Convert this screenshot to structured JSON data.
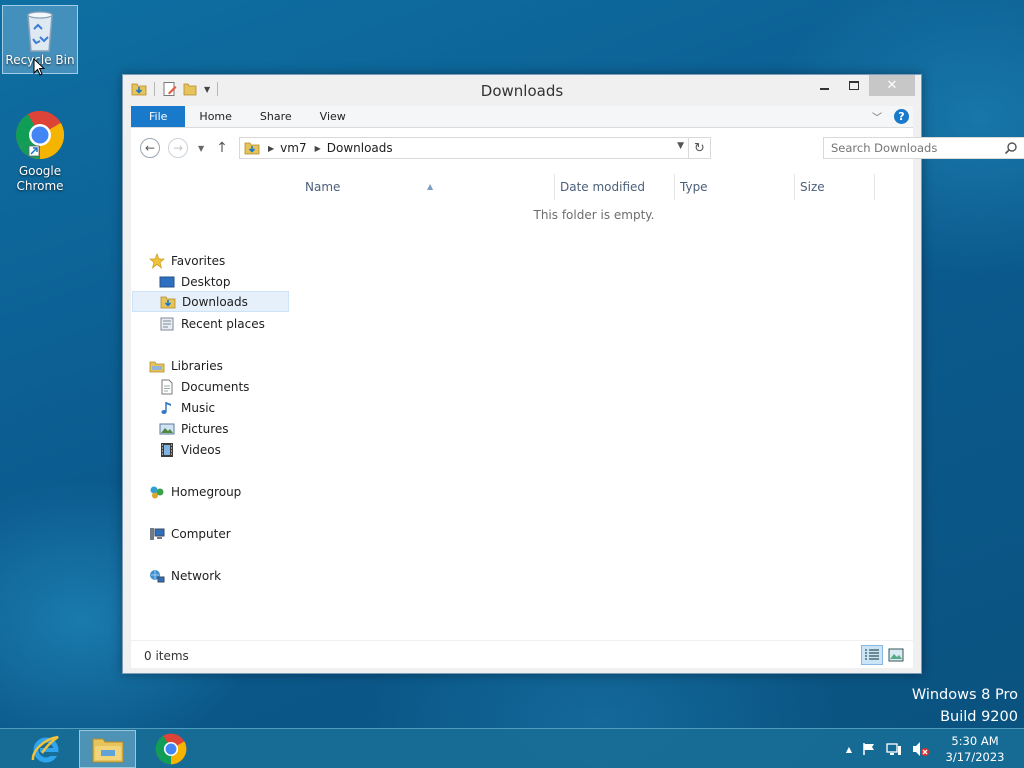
{
  "desktop": {
    "icons": [
      {
        "label": "Recycle Bin"
      },
      {
        "label": "Google Chrome"
      }
    ]
  },
  "window": {
    "title": "Downloads",
    "ribbon_tabs": [
      "File",
      "Home",
      "Share",
      "View"
    ],
    "address": {
      "crumbs": [
        "vm7",
        "Downloads"
      ]
    },
    "search": {
      "placeholder": "Search Downloads"
    },
    "nav": {
      "favorites": {
        "label": "Favorites",
        "items": [
          "Desktop",
          "Downloads",
          "Recent places"
        ]
      },
      "libraries": {
        "label": "Libraries",
        "items": [
          "Documents",
          "Music",
          "Pictures",
          "Videos"
        ]
      },
      "homegroup": "Homegroup",
      "computer": "Computer",
      "network": "Network"
    },
    "columns": [
      "Name",
      "Date modified",
      "Type",
      "Size"
    ],
    "empty_message": "This folder is empty.",
    "status": "0 items"
  },
  "watermark": {
    "line1": "Windows 8 Pro",
    "line2": "Build 9200"
  },
  "taskbar": {
    "clock_time": "5:30 AM",
    "clock_date": "3/17/2023"
  },
  "colors": {
    "accent": "#1979ca",
    "selection": "#e5f0fb",
    "taskbar": "#186e96"
  }
}
